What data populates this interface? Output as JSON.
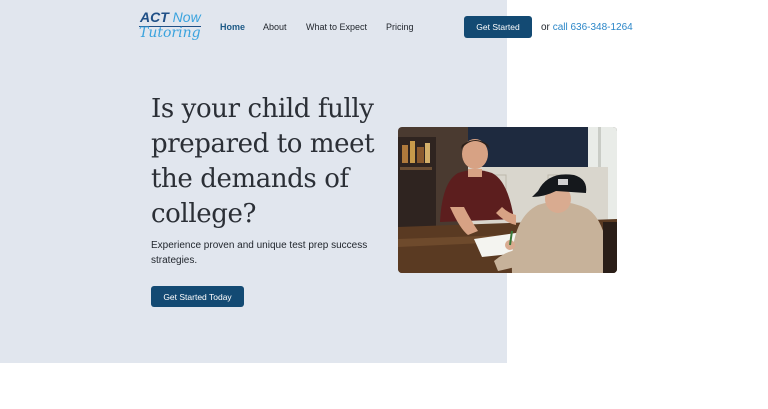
{
  "header": {
    "logo": {
      "act": "ACT",
      "now": "Now",
      "tutoring": "Tutoring"
    },
    "nav": [
      {
        "label": "Home",
        "active": true
      },
      {
        "label": "About",
        "active": false
      },
      {
        "label": "What to Expect",
        "active": false
      },
      {
        "label": "Pricing",
        "active": false
      }
    ],
    "cta_label": "Get Started",
    "call_prefix": "or",
    "call_link": "call 636-348-1264"
  },
  "hero": {
    "headline": "Is your child fully prepared to meet the demands of college?",
    "subtext": "Experience proven and unique test prep success strategies.",
    "cta_label": "Get Started Today",
    "photo_alt": "Tutor working with a student at a table"
  },
  "colors": {
    "hero_background": "#e1e6ee",
    "button": "#134a73",
    "link": "#2a86c8",
    "logo_dark": "#1f4f86",
    "logo_light": "#3aa3de"
  }
}
